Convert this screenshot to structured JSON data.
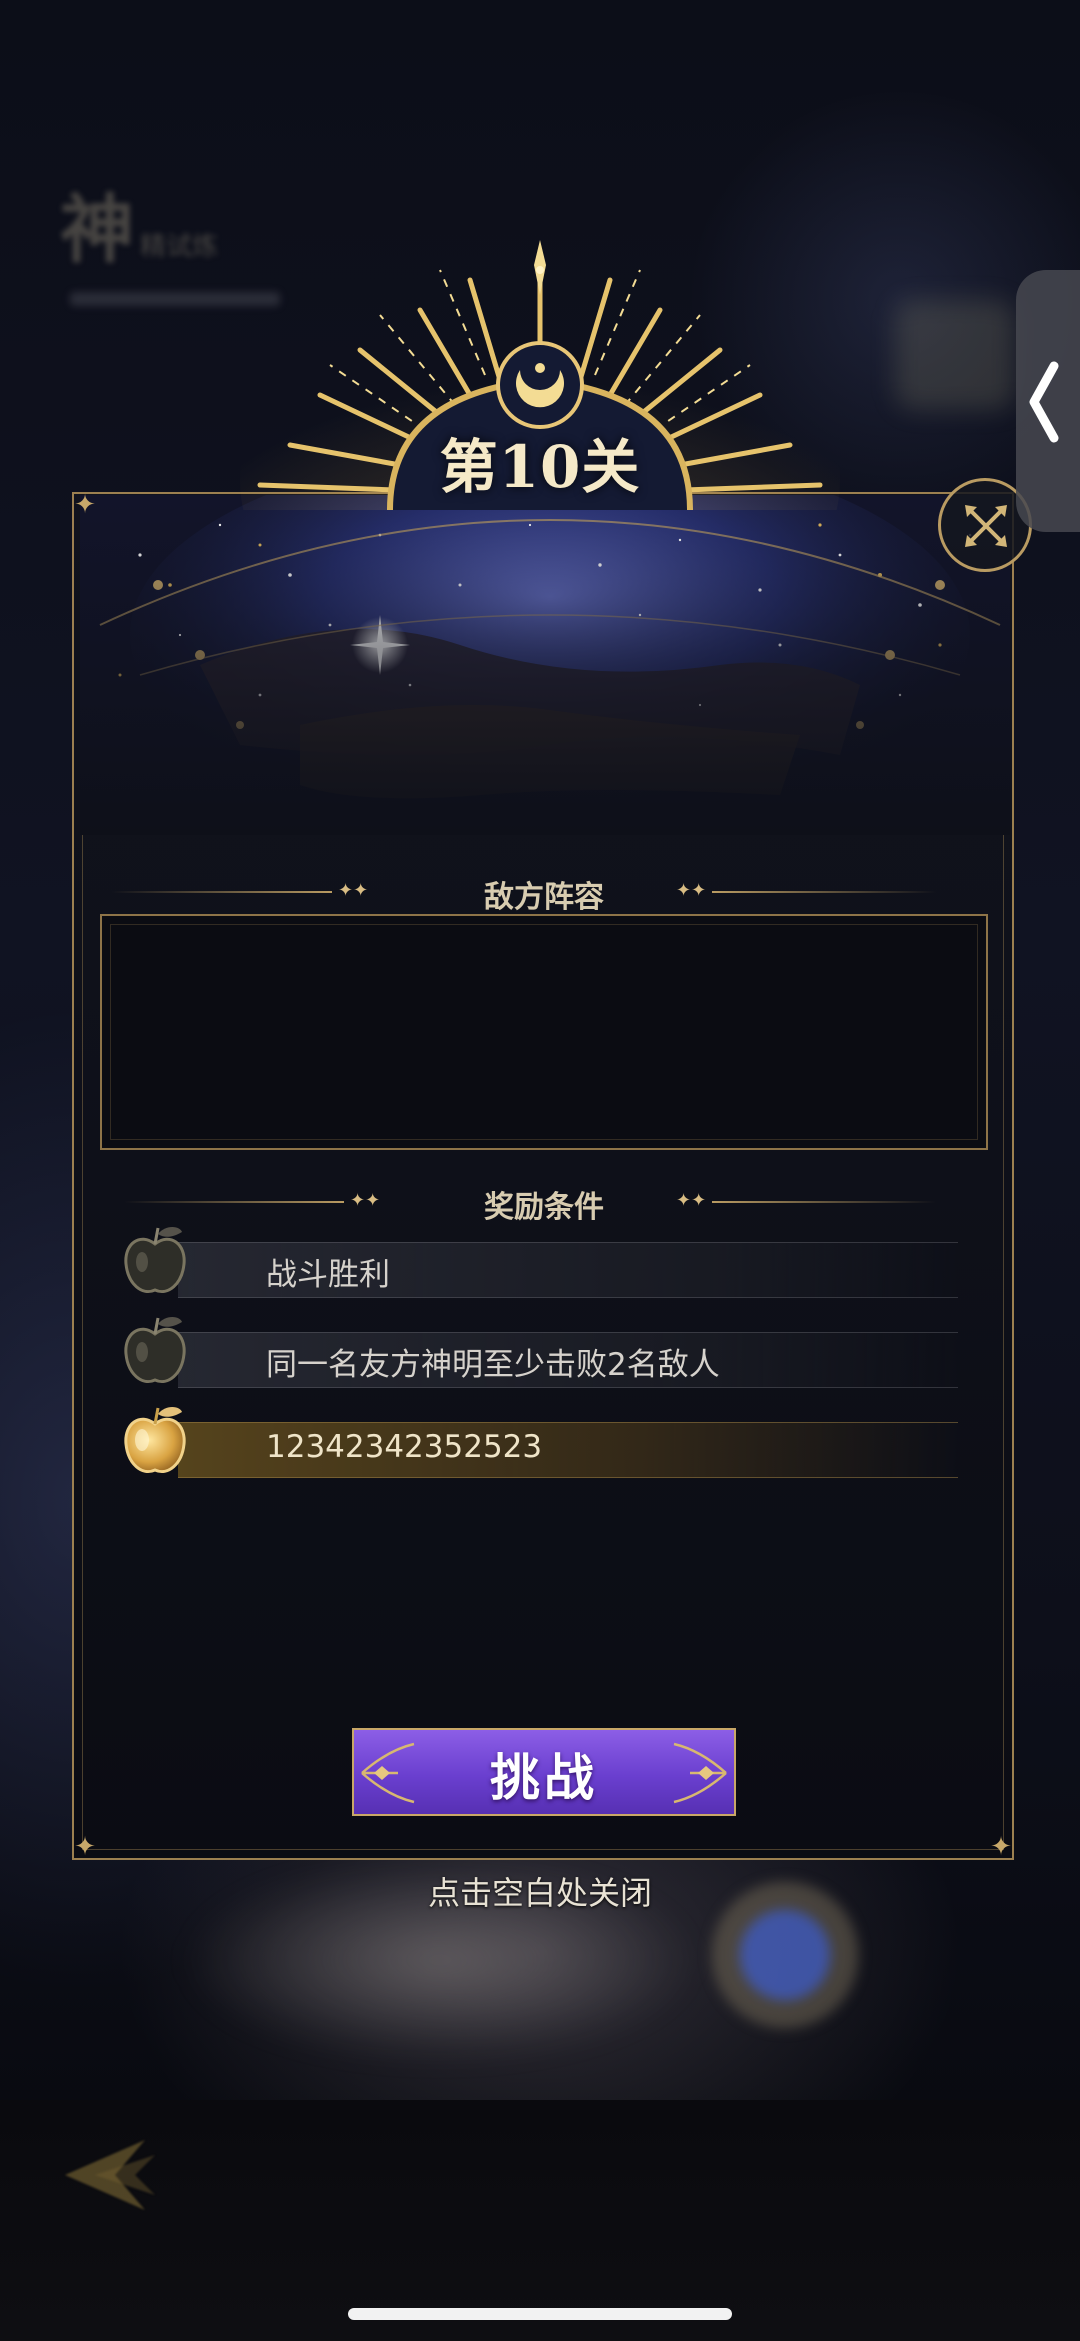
{
  "stage": {
    "title": "第10关"
  },
  "background": {
    "mode_title": "神",
    "mode_subtitle": "精试炼"
  },
  "sections": {
    "enemy_lineup": "敌方阵容",
    "reward_conditions": "奖励条件"
  },
  "rewards": [
    {
      "text": "战斗胜利",
      "achieved": false
    },
    {
      "text": "同一名友方神明至少击败2名敌人",
      "achieved": false
    },
    {
      "text": "12342342352523",
      "achieved": true
    }
  ],
  "buttons": {
    "challenge": "挑战",
    "close_hint": "点击空白处关闭"
  },
  "icons": {
    "close": "close-x-icon",
    "back": "back-arrow-icon",
    "side_tab": "chevron-left-icon",
    "reward": "apple-icon"
  },
  "colors": {
    "gold": "#b99b62",
    "button_purple": "#6a3fcf",
    "apple_gold": "#e0b25a",
    "apple_dark": "#3a3a30"
  }
}
